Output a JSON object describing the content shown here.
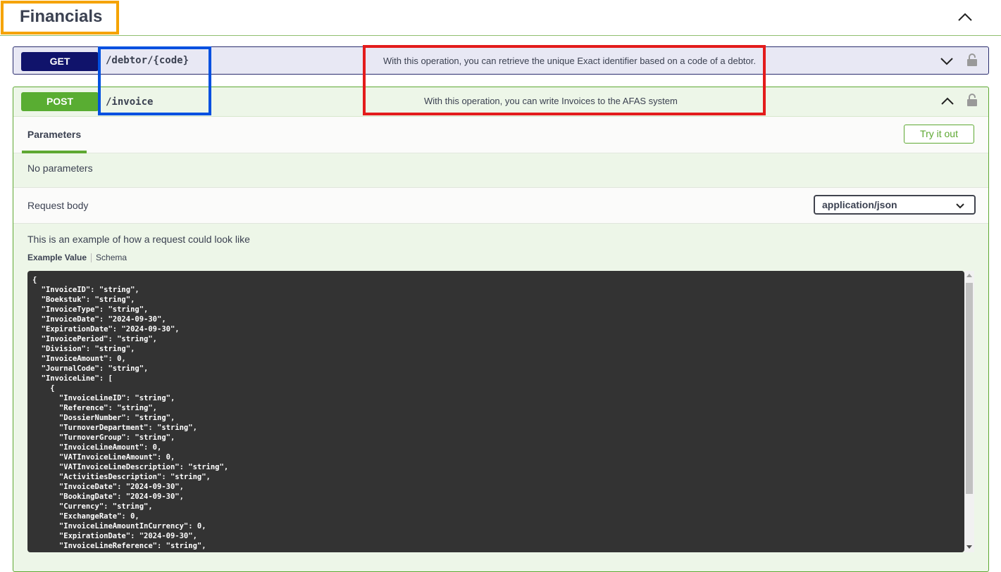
{
  "section": {
    "title": "Financials",
    "toggle_icon": "chevron-up-icon"
  },
  "get_op": {
    "method": "GET",
    "path": "/debtor/{code}",
    "summary": "With this operation, you can retrieve the unique Exact identifier based on a code of a debtor.",
    "expand_icon": "chevron-down-icon",
    "lock_icon": "lock-icon"
  },
  "post_op": {
    "method": "POST",
    "path": "/invoice",
    "summary": "With this operation, you can write Invoices to the AFAS system",
    "collapse_icon": "chevron-up-icon",
    "lock_icon": "lock-icon",
    "tab_label": "Parameters",
    "try_button": "Try it out",
    "no_params": "No parameters",
    "request_body_label": "Request body",
    "content_type": "application/json",
    "example_description": "This is an example of how a request could look like",
    "example_tabs": [
      "Example Value",
      "Schema"
    ],
    "example_code": "{\n  \"InvoiceID\": \"string\",\n  \"Boekstuk\": \"string\",\n  \"InvoiceType\": \"string\",\n  \"InvoiceDate\": \"2024-09-30\",\n  \"ExpirationDate\": \"2024-09-30\",\n  \"InvoicePeriod\": \"string\",\n  \"Division\": \"string\",\n  \"InvoiceAmount\": 0,\n  \"JournalCode\": \"string\",\n  \"InvoiceLine\": [\n    {\n      \"InvoiceLineID\": \"string\",\n      \"Reference\": \"string\",\n      \"DossierNumber\": \"string\",\n      \"TurnoverDepartment\": \"string\",\n      \"TurnoverGroup\": \"string\",\n      \"InvoiceLineAmount\": 0,\n      \"VATInvoiceLineAmount\": 0,\n      \"VATInvoiceLineDescription\": \"string\",\n      \"ActivitiesDescription\": \"string\",\n      \"InvoiceDate\": \"2024-09-30\",\n      \"BookingDate\": \"2024-09-30\",\n      \"Currency\": \"string\",\n      \"ExchangeRate\": 0,\n      \"InvoiceLineAmountInCurrency\": 0,\n      \"ExpirationDate\": \"2024-09-30\",\n      \"InvoiceLineReference\": \"string\","
  },
  "colors": {
    "get": "#10136b",
    "post": "#59ad32",
    "annotation_orange": "#f5a300",
    "annotation_blue": "#0050e0",
    "annotation_red": "#e31c1c"
  }
}
